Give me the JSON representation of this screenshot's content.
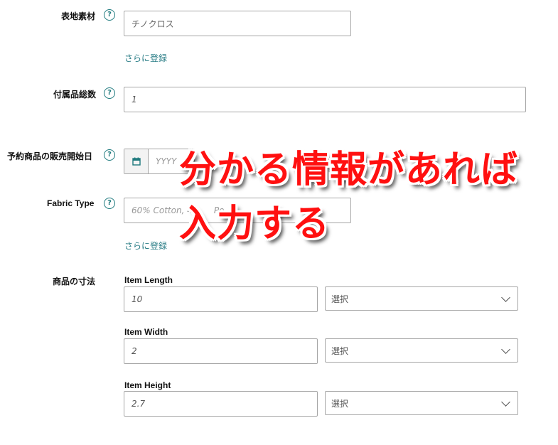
{
  "fields": {
    "surface_material": {
      "label": "表地素材",
      "value": "チノクロス",
      "add_more": "さらに登録"
    },
    "accessory_count": {
      "label": "付属品総数",
      "value": "1"
    },
    "preorder_date": {
      "label": "予約商品の販売開始日",
      "placeholder": "YYYY"
    },
    "fabric_type": {
      "label": "Fabric Type",
      "placeholder": "60% Cotton, 4",
      "placeholder_tail": "Po",
      "add_more": "さらに登録"
    },
    "dimensions": {
      "label": "商品の寸法",
      "length": {
        "label": "Item Length",
        "value": "10",
        "unit": "選択"
      },
      "width": {
        "label": "Item Width",
        "value": "2",
        "unit": "選択"
      },
      "height": {
        "label": "Item Height",
        "value": "2.7",
        "unit": "選択"
      }
    }
  },
  "help_glyph": "?",
  "overlay": {
    "line1": "分かる情報があれば",
    "line2": "入力する",
    "color": "#ff1010"
  }
}
